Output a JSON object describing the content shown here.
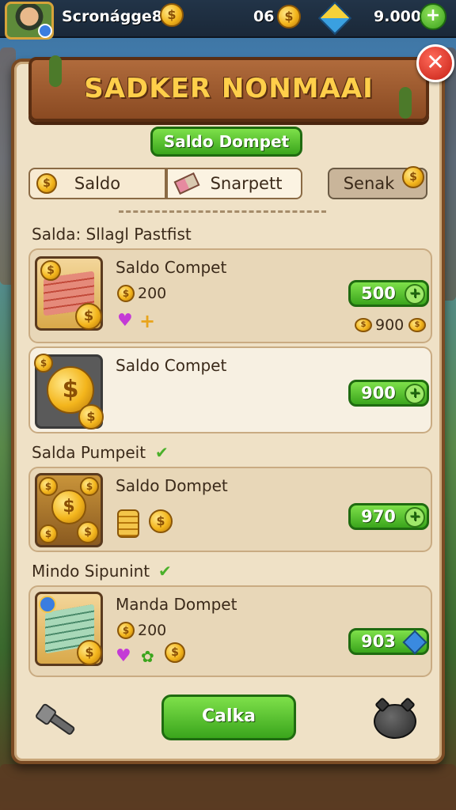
{
  "topbar": {
    "player_name": "Scronágge80",
    "currency_a": "06",
    "currency_b": "9.000",
    "plus": "+"
  },
  "panel": {
    "title": "SADKER NONMAAI",
    "close_label": "✕",
    "header_button": "Saldo Dompet",
    "tabs": [
      {
        "label": "Saldo",
        "active": false
      },
      {
        "label": "Snarpett",
        "active": true
      },
      {
        "label": "Senak",
        "active": false
      }
    ]
  },
  "sections": [
    {
      "label": "Salda: Sllagl Pastfist",
      "items": [
        {
          "title": "Saldo Compet",
          "coin_amount": "200",
          "price": "500",
          "sub_price": "900"
        },
        {
          "title": "Saldo Compet",
          "price": "900"
        }
      ]
    },
    {
      "label": "Salda Pumpeit",
      "items": [
        {
          "title": "Saldo Dompet",
          "price": "970"
        }
      ]
    },
    {
      "label": "Mindo Sipunint",
      "items": [
        {
          "title": "Manda Dompet",
          "coin_amount": "200",
          "price": "903"
        }
      ]
    }
  ],
  "footer": {
    "main_button": "Calka"
  },
  "colors": {
    "green": "#3aa51c",
    "gold": "#f3b51c",
    "panel": "#efe1c6",
    "wood": "#8a4a22"
  },
  "icons": [
    "avatar",
    "coin-icon",
    "gem-icon",
    "plus-icon",
    "close-icon",
    "money-stack-icon",
    "heart-icon",
    "tool-icon",
    "piggy-bank-icon"
  ]
}
